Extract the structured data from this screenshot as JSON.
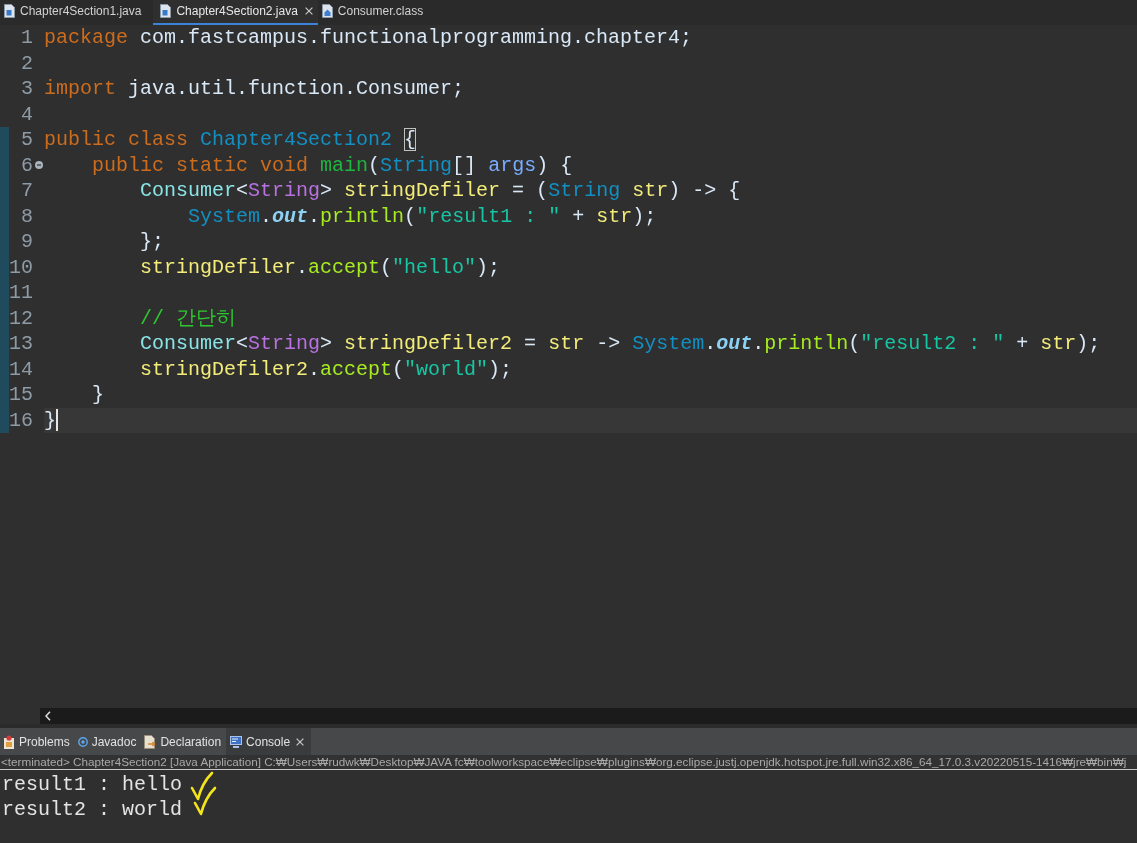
{
  "editor_tabs": [
    {
      "label": "Chapter4Section1.java",
      "kind": "java",
      "selected": false
    },
    {
      "label": "Chapter4Section2.java",
      "kind": "java",
      "selected": true
    },
    {
      "label": "Consumer.class",
      "kind": "class",
      "selected": false
    }
  ],
  "editor": {
    "lines": [
      {
        "number": "1",
        "changed": false,
        "fold_marker": false,
        "current": false,
        "tokens": [
          {
            "kind": "keyword",
            "text": "package "
          },
          {
            "kind": "plain",
            "text": "com.fastcampus.functionalprogramming.chapter4;"
          }
        ]
      },
      {
        "number": "2",
        "changed": false,
        "fold_marker": false,
        "current": false
      },
      {
        "number": "3",
        "changed": false,
        "fold_marker": false,
        "current": false,
        "tokens": [
          {
            "kind": "keyword",
            "text": "import "
          },
          {
            "kind": "plain",
            "text": "java.util.function.Consumer;"
          }
        ]
      },
      {
        "number": "4",
        "changed": false,
        "fold_marker": false,
        "current": false
      },
      {
        "number": "5",
        "changed": true,
        "fold_marker": false,
        "current": false,
        "tokens": [
          {
            "kind": "keyword",
            "text": "public class "
          },
          {
            "kind": "class",
            "text": "Chapter4Section2 "
          },
          {
            "kind": "matched_bracket",
            "text": "{"
          }
        ]
      },
      {
        "number": "6",
        "changed": true,
        "fold_marker": true,
        "current": false,
        "tokens": [
          {
            "kind": "keyword",
            "text": "    public static void "
          },
          {
            "kind": "method_declaration",
            "text": "main"
          },
          {
            "kind": "plain",
            "text": "("
          },
          {
            "kind": "class",
            "text": "String"
          },
          {
            "kind": "plain",
            "text": "[] "
          },
          {
            "kind": "parameter",
            "text": "args"
          },
          {
            "kind": "plain",
            "text": ") {"
          }
        ]
      },
      {
        "number": "7",
        "changed": true,
        "fold_marker": false,
        "current": false,
        "tokens": [
          {
            "kind": "interface",
            "text": "        Consumer"
          },
          {
            "kind": "plain",
            "text": "<"
          },
          {
            "kind": "type_argument",
            "text": "String"
          },
          {
            "kind": "plain",
            "text": "> "
          },
          {
            "kind": "local",
            "text": "stringDefiler"
          },
          {
            "kind": "plain",
            "text": " = ("
          },
          {
            "kind": "class",
            "text": "String "
          },
          {
            "kind": "local",
            "text": "str"
          },
          {
            "kind": "plain",
            "text": ") -> {"
          }
        ]
      },
      {
        "number": "8",
        "changed": true,
        "fold_marker": false,
        "current": false,
        "tokens": [
          {
            "kind": "class",
            "text": "            System"
          },
          {
            "kind": "plain",
            "text": "."
          },
          {
            "kind": "static_field",
            "text": "out"
          },
          {
            "kind": "plain",
            "text": "."
          },
          {
            "kind": "method",
            "text": "println"
          },
          {
            "kind": "plain",
            "text": "("
          },
          {
            "kind": "string",
            "text": "\"result1 : \""
          },
          {
            "kind": "plain",
            "text": " + "
          },
          {
            "kind": "local",
            "text": "str"
          },
          {
            "kind": "plain",
            "text": ");"
          }
        ]
      },
      {
        "number": "9",
        "changed": true,
        "fold_marker": false,
        "current": false,
        "tokens": [
          {
            "kind": "plain",
            "text": "        };"
          }
        ]
      },
      {
        "number": "10",
        "changed": true,
        "fold_marker": false,
        "current": false,
        "tokens": [
          {
            "kind": "local",
            "text": "        stringDefiler"
          },
          {
            "kind": "plain",
            "text": "."
          },
          {
            "kind": "method",
            "text": "accept"
          },
          {
            "kind": "plain",
            "text": "("
          },
          {
            "kind": "string",
            "text": "\"hello\""
          },
          {
            "kind": "plain",
            "text": ");"
          }
        ]
      },
      {
        "number": "11",
        "changed": true,
        "fold_marker": false,
        "current": false
      },
      {
        "number": "12",
        "changed": true,
        "fold_marker": false,
        "current": false,
        "tokens": [
          {
            "kind": "comment",
            "text": "        // 간단히"
          }
        ]
      },
      {
        "number": "13",
        "changed": true,
        "fold_marker": false,
        "current": false,
        "tokens": [
          {
            "kind": "interface",
            "text": "        Consumer"
          },
          {
            "kind": "plain",
            "text": "<"
          },
          {
            "kind": "type_argument",
            "text": "String"
          },
          {
            "kind": "plain",
            "text": "> "
          },
          {
            "kind": "local",
            "text": "stringDefiler2"
          },
          {
            "kind": "plain",
            "text": " = "
          },
          {
            "kind": "local",
            "text": "str"
          },
          {
            "kind": "plain",
            "text": " -> "
          },
          {
            "kind": "class",
            "text": "System"
          },
          {
            "kind": "plain",
            "text": "."
          },
          {
            "kind": "static_field",
            "text": "out"
          },
          {
            "kind": "plain",
            "text": "."
          },
          {
            "kind": "method",
            "text": "println"
          },
          {
            "kind": "plain",
            "text": "("
          },
          {
            "kind": "string",
            "text": "\"result2 : \""
          },
          {
            "kind": "plain",
            "text": " + "
          },
          {
            "kind": "local",
            "text": "str"
          },
          {
            "kind": "plain",
            "text": ");"
          }
        ]
      },
      {
        "number": "14",
        "changed": true,
        "fold_marker": false,
        "current": false,
        "tokens": [
          {
            "kind": "local",
            "text": "        stringDefiler2"
          },
          {
            "kind": "plain",
            "text": "."
          },
          {
            "kind": "method",
            "text": "accept"
          },
          {
            "kind": "plain",
            "text": "("
          },
          {
            "kind": "string",
            "text": "\"world\""
          },
          {
            "kind": "plain",
            "text": ");"
          }
        ]
      },
      {
        "number": "15",
        "changed": true,
        "fold_marker": false,
        "current": false,
        "tokens": [
          {
            "kind": "plain",
            "text": "    }"
          }
        ]
      },
      {
        "number": "16",
        "changed": true,
        "fold_marker": false,
        "current": true,
        "tokens": [
          {
            "kind": "plain",
            "text": "}"
          }
        ]
      }
    ]
  },
  "panel_tabs": [
    {
      "label": "Problems",
      "kind": "problems",
      "selected": false
    },
    {
      "label": "Javadoc",
      "kind": "javadoc",
      "selected": false
    },
    {
      "label": "Declaration",
      "kind": "declaration",
      "selected": false
    },
    {
      "label": "Console",
      "kind": "console",
      "selected": true
    }
  ],
  "console": {
    "status": "<terminated> Chapter4Section2 [Java Application] C:₩Users₩rudwk₩Desktop₩JAVA fc₩toolworkspace₩eclipse₩plugins₩org.eclipse.justj.openjdk.hotspot.jre.full.win32.x86_64_17.0.3.v20220515-1416₩jre₩bin₩j",
    "output": [
      {
        "text": "result1 : hello",
        "ticked": true
      },
      {
        "text": "result2 : world",
        "ticked": true
      }
    ]
  }
}
